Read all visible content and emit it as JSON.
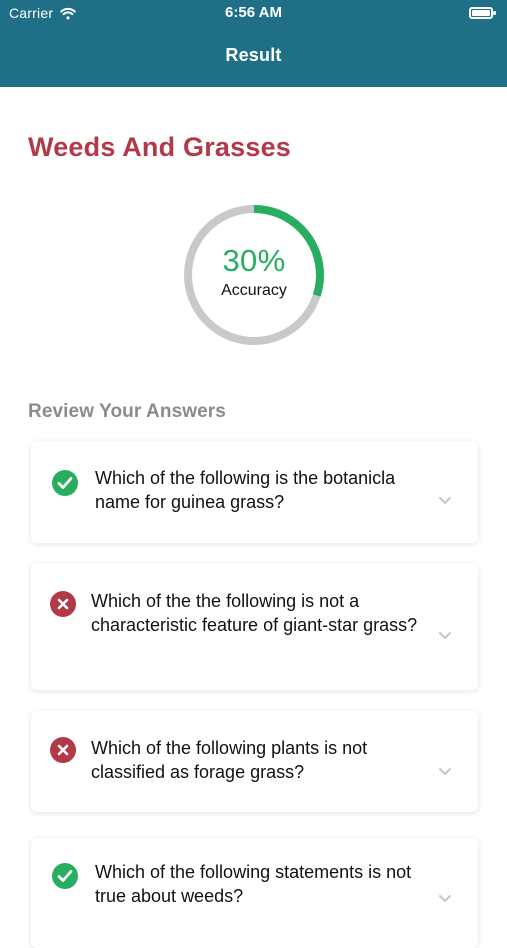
{
  "status_bar": {
    "carrier": "Carrier",
    "time": "6:56 AM"
  },
  "nav": {
    "title": "Result"
  },
  "quiz": {
    "title": "Weeds And Grasses"
  },
  "accuracy": {
    "percent_text": "30%",
    "label": "Accuracy",
    "fraction": 0.3
  },
  "review": {
    "heading": "Review Your Answers",
    "items": [
      {
        "question": "Which of the following is the botanicla name for guinea grass?",
        "status": "correct"
      },
      {
        "question": "Which of the the following is not a characteristic feature of giant-star grass?",
        "status": "incorrect"
      },
      {
        "question": "Which of the following plants is not classified as forage grass?",
        "status": "incorrect"
      },
      {
        "question": "Which of the following statements is not true about weeds?",
        "status": "correct"
      }
    ]
  },
  "colors": {
    "header": "#1f6f86",
    "title": "#b23a48",
    "correct": "#27ae60",
    "incorrect": "#b23a48",
    "ring_track": "#c9c9c9"
  },
  "icons": {
    "wifi": "wifi-icon",
    "battery": "battery-icon",
    "correct": "check-circle-icon",
    "incorrect": "x-circle-icon",
    "expand": "chevron-down-icon"
  }
}
